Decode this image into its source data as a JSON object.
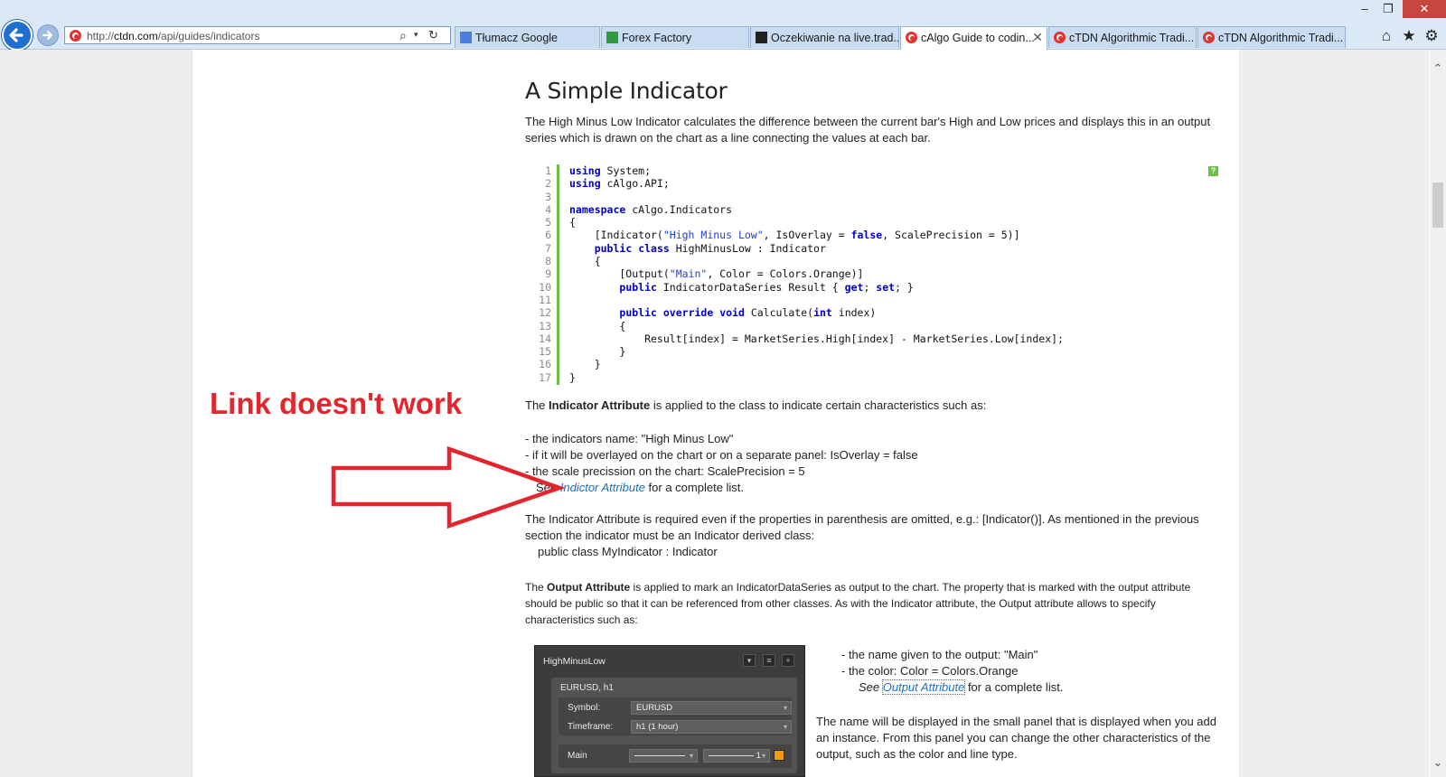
{
  "browser": {
    "url_prefix": "http://",
    "url_host": "ctdn.com",
    "url_path": "/api/guides/indicators",
    "tabs": [
      {
        "label": "Tłumacz Google"
      },
      {
        "label": "Forex Factory"
      },
      {
        "label": "Oczekiwanie na live.trad..."
      },
      {
        "label": "cAlgo Guide to codin...",
        "active": true
      },
      {
        "label": "cTDN Algorithmic Tradi..."
      },
      {
        "label": "cTDN Algorithmic Tradi..."
      }
    ],
    "close_glyph": "✕"
  },
  "article": {
    "title": "A Simple Indicator",
    "intro": "The High Minus Low Indicator calculates the difference between the current bar's High and Low prices and displays this in an output series which is drawn on the chart as a line connecting the values at each bar.",
    "help_icon": "?",
    "indicator_attr": {
      "pre": "The ",
      "bold": "Indicator Attribute",
      "post": " is applied to the class to indicate certain characteristics such as:",
      "bullets": [
        "- the indicators name: \"High Minus Low\"",
        "- if it will be overlayed on the chart or on a separate panel: IsOverlay = false",
        "- the scale precission on the chart: ScalePrecision = 5"
      ],
      "see_pre": "See ",
      "see_link": "Indictor Attribute",
      "see_post": " for a complete list."
    },
    "required_text": "The Indicator Attribute is required even if the properties in parenthesis are omitted, e.g.: [Indicator()].  As mentioned in the previous section the indicator must be an Indicator derived class:",
    "class_line": "public class MyIndicator : Indicator",
    "output_attr": {
      "pre": "The ",
      "bold": "Output Attribute",
      "post": " is applied to mark an IndicatorDataSeries as output to the chart. The property that is marked with the output attribute should be public so that it can be referenced from other classes. As with the Indicator attribute, the Output attribute allows to specify characteristics such as:",
      "bullets": [
        "- the name given to the output: \"Main\"",
        "- the color: Color = Colors.Orange"
      ],
      "see_pre": "See ",
      "see_link": "Output Attribute",
      "see_post": " for a complete list."
    },
    "panel_text": "The name will be displayed in the small panel that is displayed when you add an instance. From this panel you can change the other characteristics of the output, such as the color and line type."
  },
  "annotation": {
    "text": "Link doesn't work",
    "color": "#e3262d"
  },
  "panel": {
    "title": "HighMinusLow",
    "subtitle": "EURUSD, h1",
    "symbol_label": "Symbol:",
    "symbol_value": "EURUSD",
    "timeframe_label": "Timeframe:",
    "timeframe_value": "h1 (1 hour)",
    "main_label": "Main",
    "thickness": "1",
    "swatch_color": "#f29b0b"
  }
}
